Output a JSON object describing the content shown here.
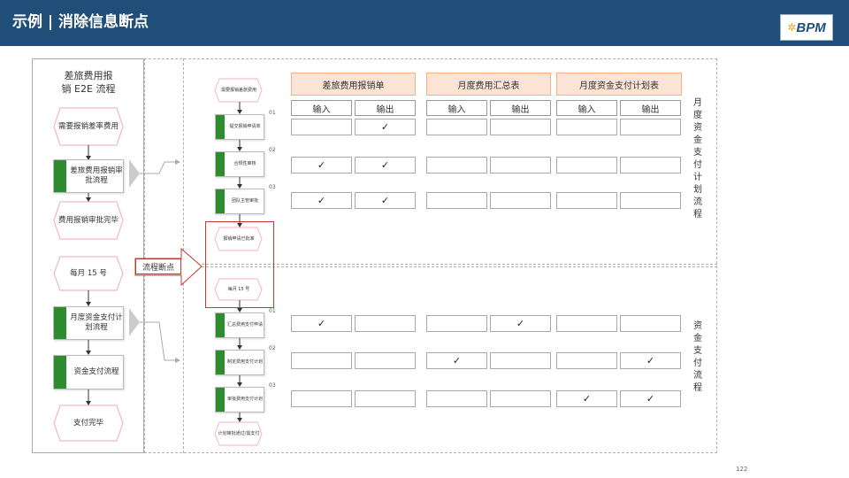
{
  "header": {
    "title": "示例 | 消除信息断点"
  },
  "logo": {
    "text": "BPM",
    "star": "✲"
  },
  "left": {
    "title_line1": "差旅费用报",
    "title_line2": "销 E2E 流程",
    "nodes": {
      "n1": "需要报销差率费用",
      "p1": "差旅费用报销审批流程",
      "n2": "费用报销审批完毕",
      "n3": "每月 15 号",
      "p2": "月度资金支付计划流程",
      "p3": "资金支付流程",
      "n4": "支付完毕"
    }
  },
  "break_label": "流程断点",
  "mid": {
    "n_start": "需要报销差旅费用",
    "s1": "提交报销申请单",
    "s2": "合规性审核",
    "s3": "团队主管审批",
    "n_approved": "报销申请已批准",
    "n_month": "每月 15 号",
    "s4": "汇总费用支付申请",
    "s5": "制定费用支付计划",
    "s6": "审批费用支付计划",
    "n_end": "计划审批通过/需支付",
    "nums": [
      "01",
      "02",
      "03",
      "01",
      "02",
      "03"
    ]
  },
  "table": {
    "groups": [
      "差旅费用报销单",
      "月度费用汇总表",
      "月度资金支付计划表"
    ],
    "in_label": "输入",
    "out_label": "输出",
    "rows": [
      [
        "",
        "✓",
        "",
        "",
        "",
        ""
      ],
      [
        "✓",
        "✓",
        "",
        "",
        "",
        ""
      ],
      [
        "✓",
        "✓",
        "",
        "",
        "",
        ""
      ],
      [
        "✓",
        "",
        "",
        "✓",
        "",
        ""
      ],
      [
        "",
        "",
        "✓",
        "",
        "",
        "✓"
      ],
      [
        "",
        "",
        "",
        "",
        "✓",
        "✓"
      ]
    ]
  },
  "right": {
    "v1": [
      "月",
      "度",
      "资",
      "金",
      "支",
      "付",
      "计",
      "划",
      "流",
      "程"
    ],
    "v2": [
      "资",
      "金",
      "支",
      "付",
      "流",
      "程"
    ]
  },
  "colors": {
    "header": "#1f4e79",
    "hex": "#f4b6c2",
    "green": "#2e8b2e",
    "table_head": "#fbe4d5",
    "break": "#c0392b"
  },
  "page_number": "122"
}
